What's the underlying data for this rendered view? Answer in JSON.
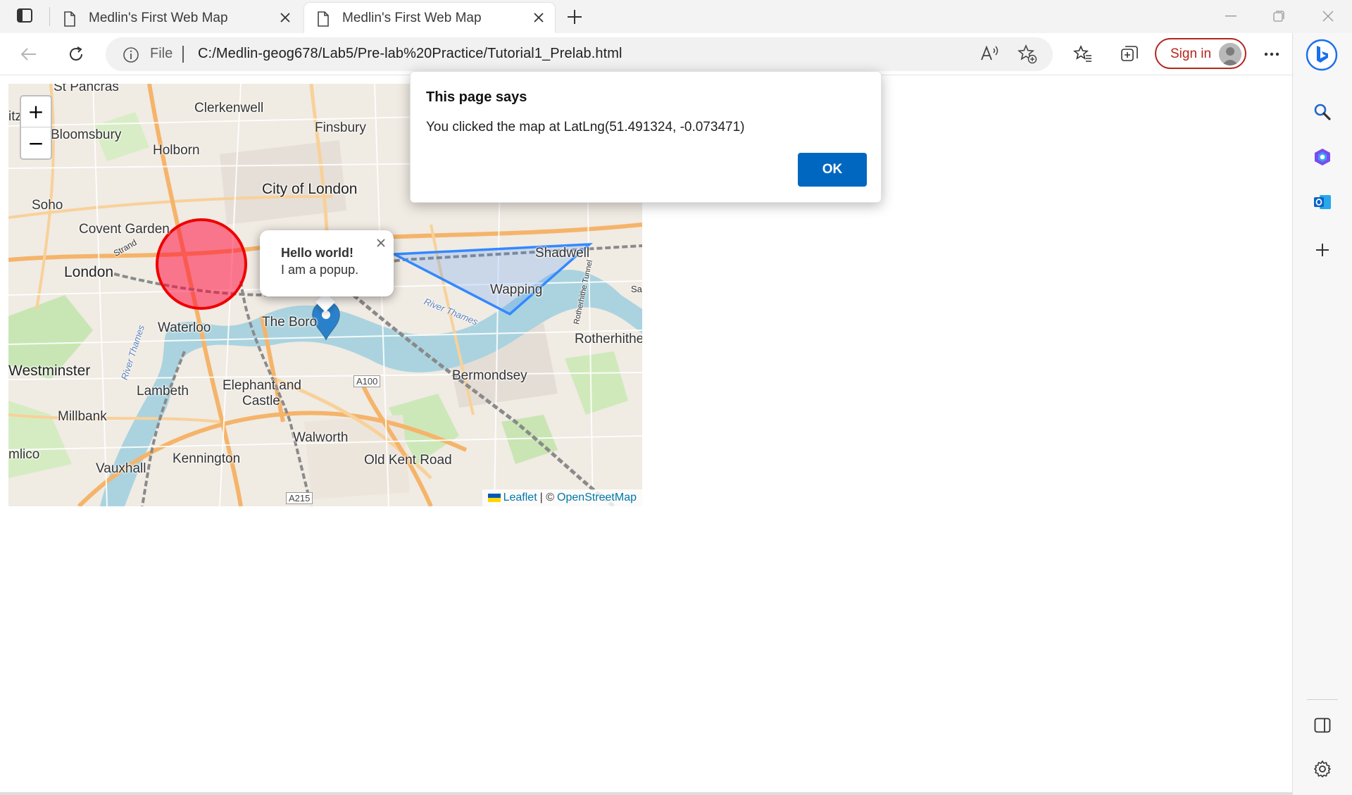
{
  "browser": {
    "tabs": [
      {
        "title": "Medlin's First Web Map",
        "active": false
      },
      {
        "title": "Medlin's First Web Map",
        "active": true
      }
    ],
    "address": {
      "scheme_label": "File",
      "url": "C:/Medlin-geog678/Lab5/Pre-lab%20Practice/Tutorial1_Prelab.html"
    },
    "signin_label": "Sign in",
    "accent_color": "#0067c0",
    "signin_color": "#b3261e",
    "icons": [
      "tab-actions-icon",
      "page-icon",
      "close-icon",
      "plus-icon",
      "minimize-icon",
      "restore-icon",
      "back-icon",
      "refresh-icon",
      "info-icon",
      "read-aloud-icon",
      "add-favorite-icon",
      "favorites-icon",
      "collections-icon",
      "more-icon",
      "bing-icon",
      "search-icon",
      "copilot-icon",
      "outlook-icon",
      "split-screen-icon",
      "settings-icon"
    ]
  },
  "dialog": {
    "title": "This page says",
    "message": "You clicked the map at LatLng(51.491324, -0.073471)",
    "ok_label": "OK"
  },
  "map": {
    "zoom_in_label": "+",
    "zoom_out_label": "−",
    "popup": {
      "title": "Hello world!",
      "text": "I am a popup."
    },
    "attribution": {
      "leaflet_label": "Leaflet",
      "separator": "| ©",
      "osm_label": "OpenStreetMap"
    },
    "places": {
      "st_pancras": "St Pancras",
      "clerkenwell": "Clerkenwell",
      "finsbury": "Finsbury",
      "bloomsbury": "Bloomsbury",
      "holborn": "Holborn",
      "city_of_london": "City of London",
      "soho": "Soho",
      "covent_garden": "Covent Garden",
      "london": "London",
      "shadwell": "Shadwell",
      "wapping": "Wapping",
      "waterloo": "Waterloo",
      "the_borough": "The Boro",
      "rotherhithe": "Rotherhithe",
      "westminster": "Westminster",
      "bermondsey": "Bermondsey",
      "lambeth": "Lambeth",
      "elephant_and_castle": "Elephant and",
      "castle": "Castle",
      "millbank": "Millbank",
      "walworth": "Walworth",
      "old_kent_road": "Old Kent Road",
      "kennington": "Kennington",
      "vauxhall": "Vauxhall",
      "pimlico": "mlico",
      "itz": "itz",
      "strand": "Strand",
      "river_thames_1": "River Thames",
      "river_thames_2": "River Thames",
      "rotherhithe_tunnel": "Rotherhithe Tunnel",
      "sal": "Sal"
    },
    "roads": {
      "a100": "A100",
      "a215": "A215"
    }
  }
}
